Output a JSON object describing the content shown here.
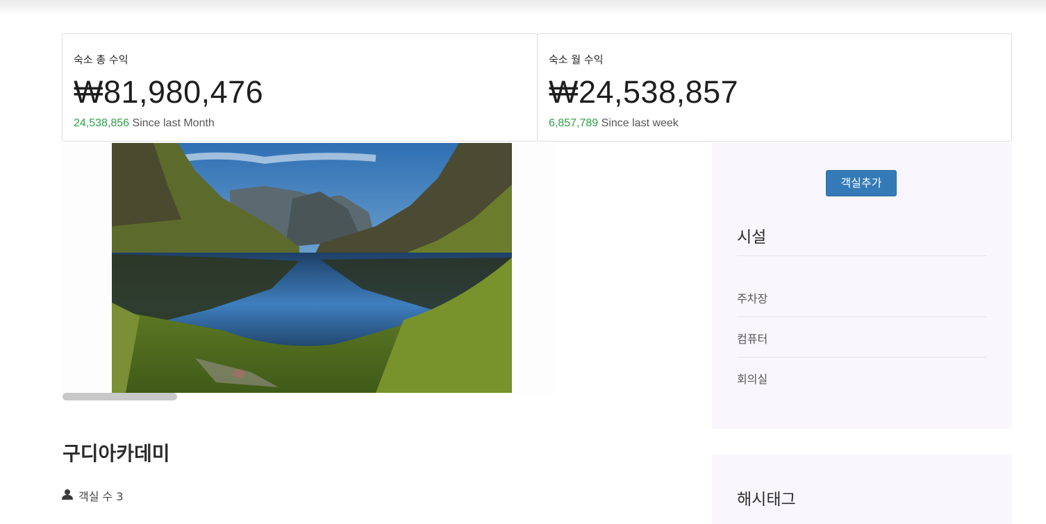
{
  "stats": {
    "total": {
      "label": "숙소 총 수익",
      "value": "₩81,980,476",
      "delta": "24,538,856",
      "since": "Since last Month"
    },
    "monthly": {
      "label": "숙소 월 수익",
      "value": "₩24,538,857",
      "delta": "6,857,789",
      "since": "Since last week"
    }
  },
  "property": {
    "name": "구디아카데미",
    "room_count": "객실 수 3"
  },
  "sidebar": {
    "add_room_button": "객실추가",
    "facilities_title": "시설",
    "facilities": [
      "주차장",
      "컴퓨터",
      "회의실"
    ],
    "hashtags_title": "해시태그"
  },
  "colors": {
    "accent": "#337ab7",
    "positive": "#2e9e48",
    "panel_bg": "#f9f7fd"
  },
  "icons": {
    "room_count": "user-icon"
  }
}
